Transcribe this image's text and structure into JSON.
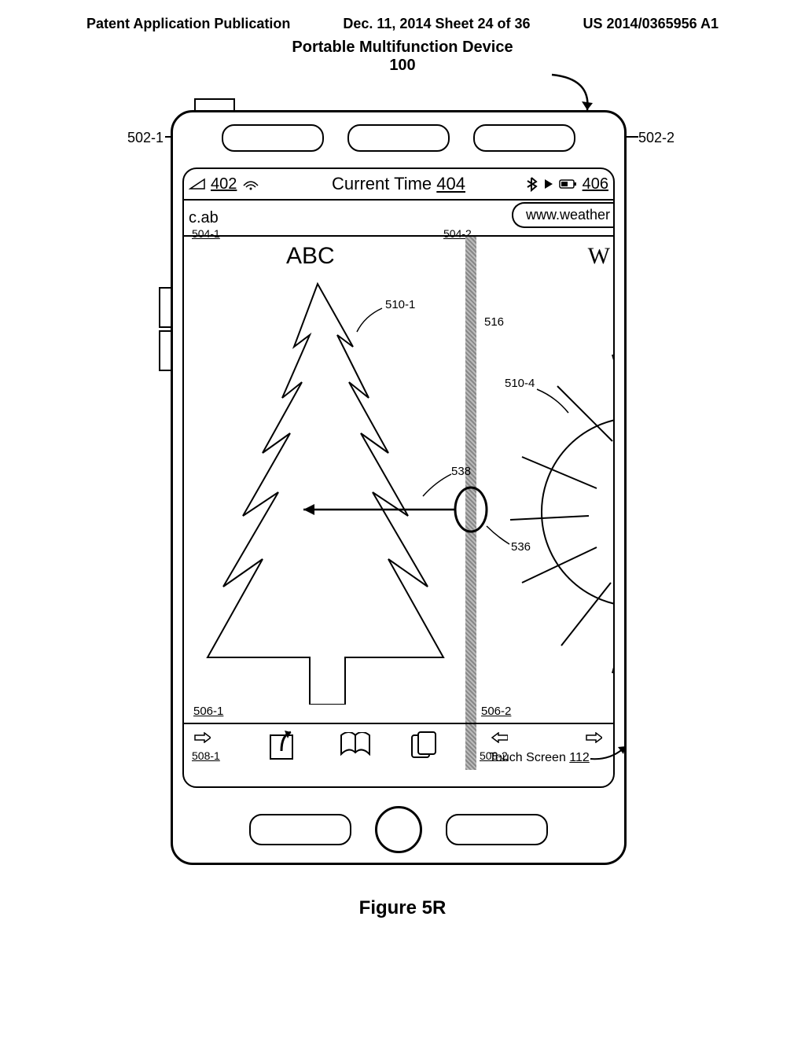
{
  "header": {
    "left": "Patent Application Publication",
    "center": "Dec. 11, 2014  Sheet 24 of 36",
    "right": "US 2014/0365956 A1"
  },
  "device": {
    "title": "Portable Multifunction Device",
    "number": "100"
  },
  "labels": {
    "l502_1": "502-1",
    "l502_2": "502-2",
    "l504_1": "504-1",
    "l504_2": "504-2",
    "l506_1": "506-1",
    "l506_2": "506-2",
    "l508_1": "508-1",
    "l508_2": "508-2",
    "l510_1": "510-1",
    "l510_4": "510-4",
    "l516": "516",
    "l536": "536",
    "l538": "538",
    "touch_screen": "Touch Screen",
    "touch_screen_num": "112"
  },
  "status": {
    "signal_ref": "402",
    "time_label": "Current Time",
    "time_ref": "404",
    "battery_ref": "406"
  },
  "url": {
    "left": "c.ab",
    "right": "www.weather"
  },
  "content": {
    "title_left": "ABC",
    "title_right": "W"
  },
  "figure_caption": "Figure 5R"
}
